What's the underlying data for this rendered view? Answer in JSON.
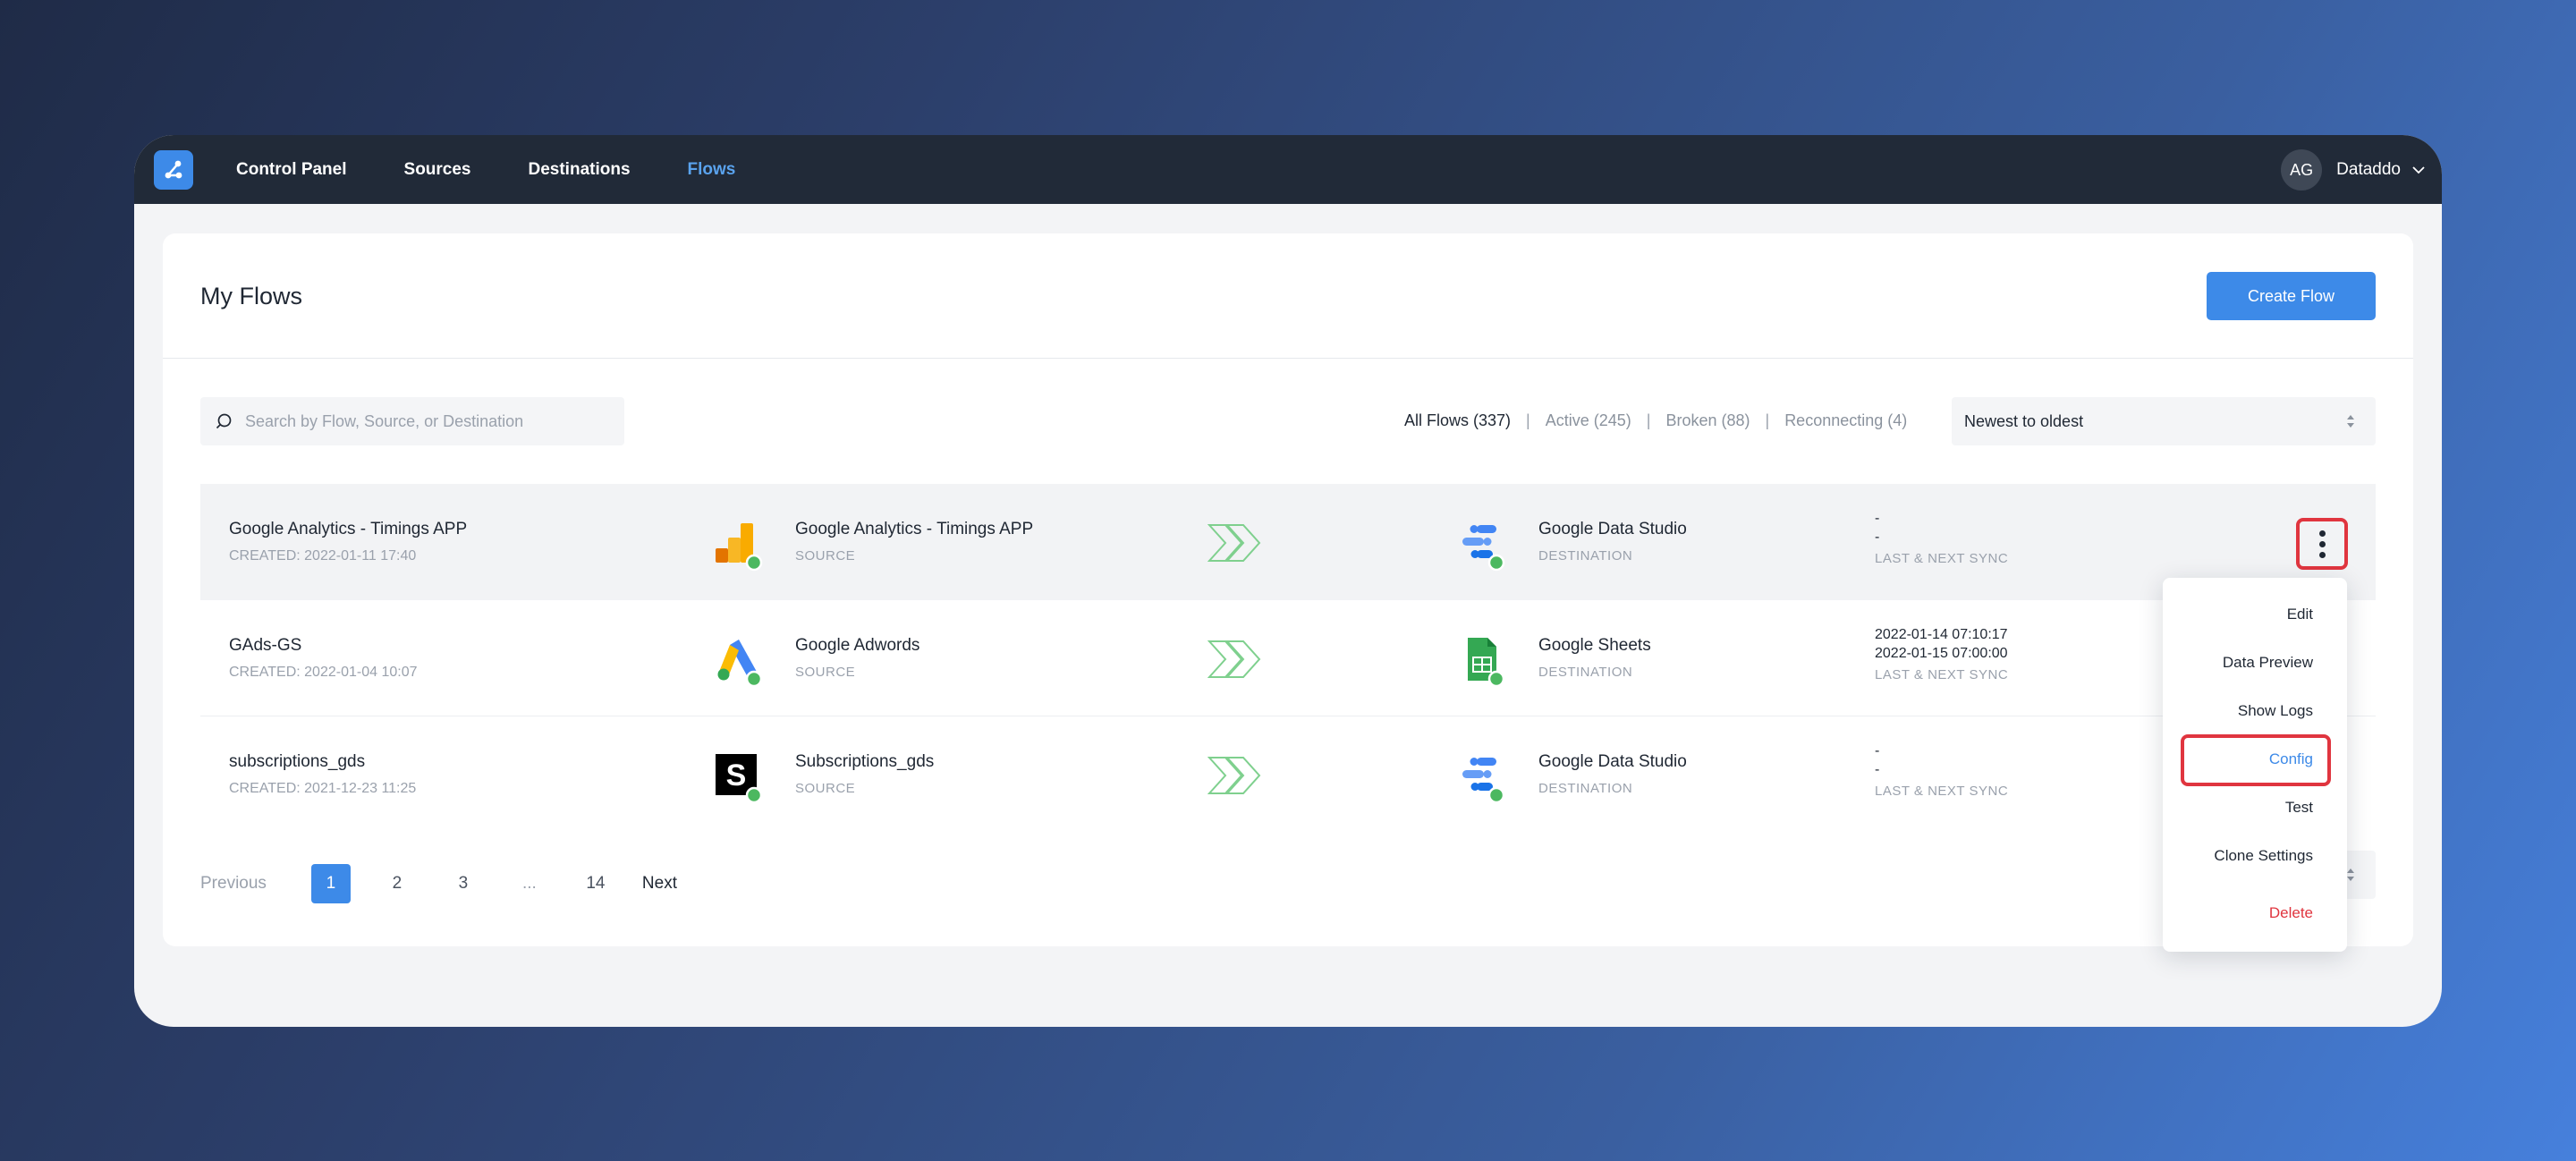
{
  "nav": {
    "items": [
      "Control Panel",
      "Sources",
      "Destinations",
      "Flows"
    ],
    "active": "Flows",
    "user_initials": "AG",
    "account_name": "Dataddo"
  },
  "page": {
    "title": "My Flows",
    "create_button": "Create Flow"
  },
  "toolbar": {
    "search_placeholder": "Search by Flow, Source, or Destination",
    "filters": [
      "All Flows (337)",
      "Active (245)",
      "Broken (88)",
      "Reconnecting (4)"
    ],
    "active_filter": "All Flows (337)",
    "sort_selected": "Newest to oldest"
  },
  "flows": [
    {
      "name": "Google Analytics - Timings APP",
      "created": "CREATED: 2022-01-11 17:40",
      "source_name": "Google Analytics - Timings APP",
      "source_label": "SOURCE",
      "source_icon": "google-analytics-icon",
      "destination_name": "Google Data Studio",
      "destination_label": "DESTINATION",
      "destination_icon": "google-data-studio-icon",
      "last_sync": "-",
      "next_sync": "-",
      "sync_label": "LAST & NEXT SYNC"
    },
    {
      "name": "GAds-GS",
      "created": "CREATED: 2022-01-04 10:07",
      "source_name": "Google Adwords",
      "source_label": "SOURCE",
      "source_icon": "google-adwords-icon",
      "destination_name": "Google Sheets",
      "destination_label": "DESTINATION",
      "destination_icon": "google-sheets-icon",
      "last_sync": "2022-01-14 07:10:17",
      "next_sync": "2022-01-15 07:00:00",
      "sync_label": "LAST & NEXT SYNC"
    },
    {
      "name": "subscriptions_gds",
      "created": "CREATED: 2021-12-23 11:25",
      "source_name": "Subscriptions_gds",
      "source_label": "SOURCE",
      "source_icon": "subscriptions-s-icon",
      "destination_name": "Google Data Studio",
      "destination_label": "DESTINATION",
      "destination_icon": "google-data-studio-icon",
      "last_sync": "-",
      "next_sync": "-",
      "sync_label": "LAST & NEXT SYNC"
    }
  ],
  "pagination": {
    "previous": "Previous",
    "pages": [
      "1",
      "2",
      "3",
      "...",
      "14"
    ],
    "current": "1",
    "next": "Next"
  },
  "context_menu": {
    "items": [
      "Edit",
      "Data Preview",
      "Show Logs",
      "Config",
      "Test",
      "Clone Settings",
      "Delete"
    ],
    "highlighted": "Config"
  },
  "colors": {
    "accent": "#3d8ae8",
    "navbar": "#212a38",
    "danger": "#e0353f",
    "status_ok": "#4cb860"
  }
}
